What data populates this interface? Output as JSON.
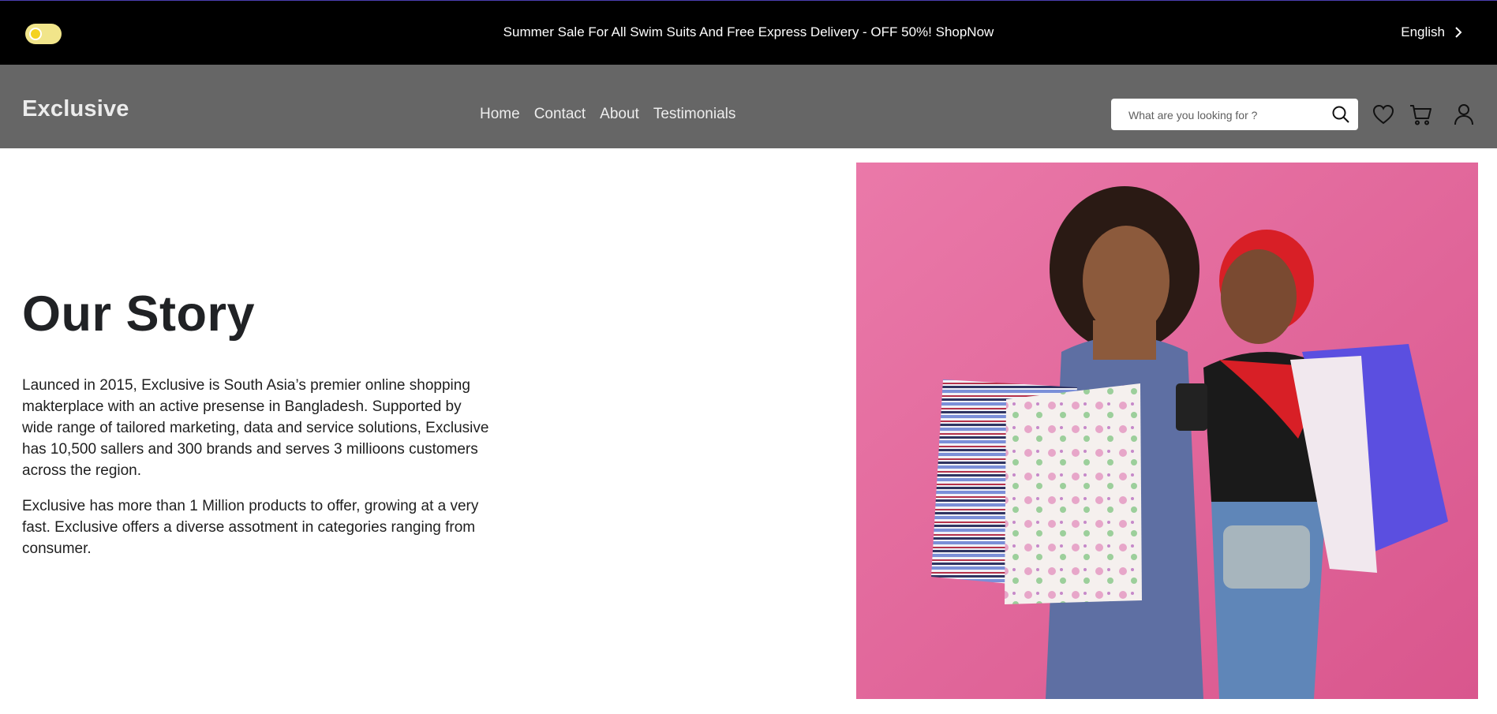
{
  "topbar": {
    "announcement": "Summer Sale For All Swim Suits And Free Express Delivery - OFF 50%! ShopNow",
    "language": "English",
    "toggle_icon": "theme-toggle",
    "lang_icon": "chevron-right-icon"
  },
  "header": {
    "logo": "Exclusive",
    "nav": [
      "Home",
      "Contact",
      "About",
      "Testimonials"
    ],
    "search_placeholder": "What are you looking for ?",
    "icons": [
      "search-icon",
      "heart-icon",
      "cart-icon",
      "user-icon"
    ]
  },
  "main": {
    "title": "Our Story",
    "paragraphs": [
      "Launced in 2015, Exclusive is South Asia’s premier online shopping makterplace with an active presense in Bangladesh. Supported by wide range of tailored marketing, data and service solutions, Exclusive has 10,500 sallers and 300 brands and serves 3 millioons customers across the region.",
      "Exclusive has more than 1 Million products to offer, growing at a very fast. Exclusive offers a diverse assotment in categories ranging from consumer."
    ]
  },
  "colors": {
    "topbar_bg": "#000000",
    "header_bg": "#666666",
    "toggle": "#f1e58a",
    "hero_bg": "#e46b9e",
    "text": "#1f1f1f"
  }
}
